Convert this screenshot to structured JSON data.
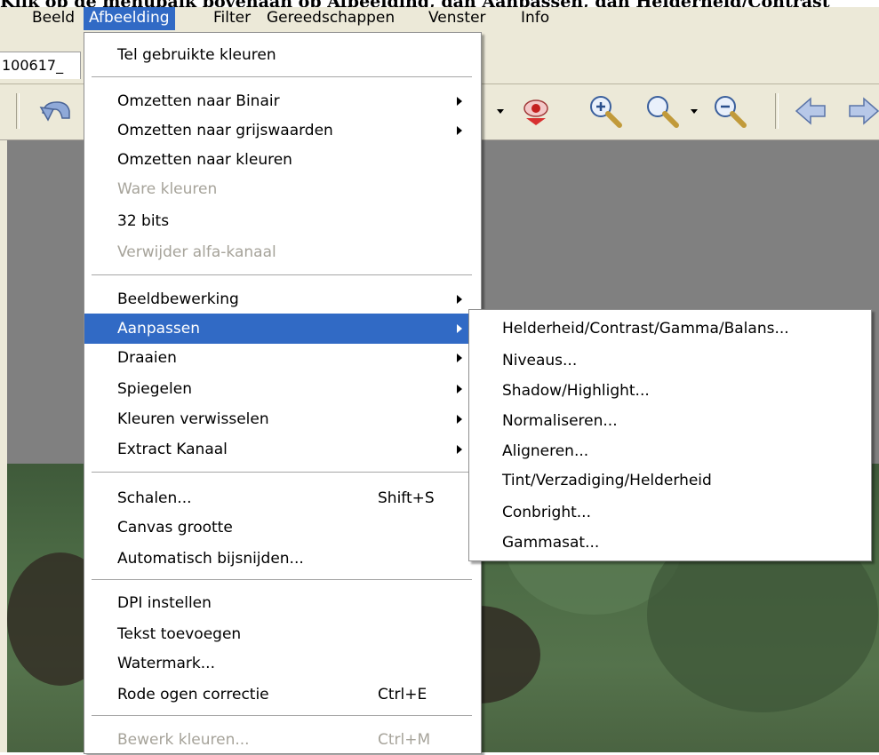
{
  "caption": "Klik op de menubalk bovenaan op Afbeelding, dan Aanpassen, dan Helderheid/Contrast",
  "menubar": [
    "Beeld",
    "Afbeelding",
    "Filter",
    "Gereedschappen",
    "Venster",
    "Info"
  ],
  "tab_label": "100617_",
  "toolbar_icons": [
    "undo-icon",
    "dropdown-arrow-icon",
    "red-eye-icon",
    "zoom-in-icon",
    "zoom-icon",
    "zoom-out-icon",
    "arrow-left-icon",
    "arrow-right-icon"
  ],
  "menu": {
    "items": [
      {
        "label": "Tel gebruikte kleuren"
      },
      {
        "label": "Omzetten naar Binair",
        "submenu": true
      },
      {
        "label": "Omzetten naar grijswaarden",
        "submenu": true
      },
      {
        "label": "Omzetten naar kleuren"
      },
      {
        "label": "Ware kleuren",
        "disabled": true
      },
      {
        "label": "32 bits"
      },
      {
        "label": "Verwijder alfa-kanaal",
        "disabled": true
      },
      {
        "label": "Beeldbewerking",
        "submenu": true
      },
      {
        "label": "Aanpassen",
        "submenu": true,
        "highlighted": true
      },
      {
        "label": "Draaien",
        "submenu": true
      },
      {
        "label": "Spiegelen",
        "submenu": true
      },
      {
        "label": "Kleuren verwisselen",
        "submenu": true
      },
      {
        "label": "Extract Kanaal",
        "submenu": true
      },
      {
        "label": "Schalen...",
        "shortcut": "Shift+S"
      },
      {
        "label": "Canvas grootte"
      },
      {
        "label": "Automatisch bijsnijden..."
      },
      {
        "label": "DPI instellen"
      },
      {
        "label": "Tekst toevoegen"
      },
      {
        "label": "Watermark..."
      },
      {
        "label": "Rode ogen correctie",
        "shortcut": "Ctrl+E"
      },
      {
        "label": "Bewerk kleuren...",
        "shortcut": "Ctrl+M",
        "disabled": true
      }
    ]
  },
  "submenu": {
    "items": [
      "Helderheid/Contrast/Gamma/Balans...",
      "Niveaus...",
      "Shadow/Highlight...",
      "Normaliseren...",
      "Aligneren...",
      "Tint/Verzadiging/Helderheid",
      "Conbright...",
      "Gammasat..."
    ]
  },
  "colors": {
    "highlight": "#316ac5",
    "chrome": "#ece9d8",
    "canvas": "#808080",
    "disabled_text": "#a6a39a"
  }
}
